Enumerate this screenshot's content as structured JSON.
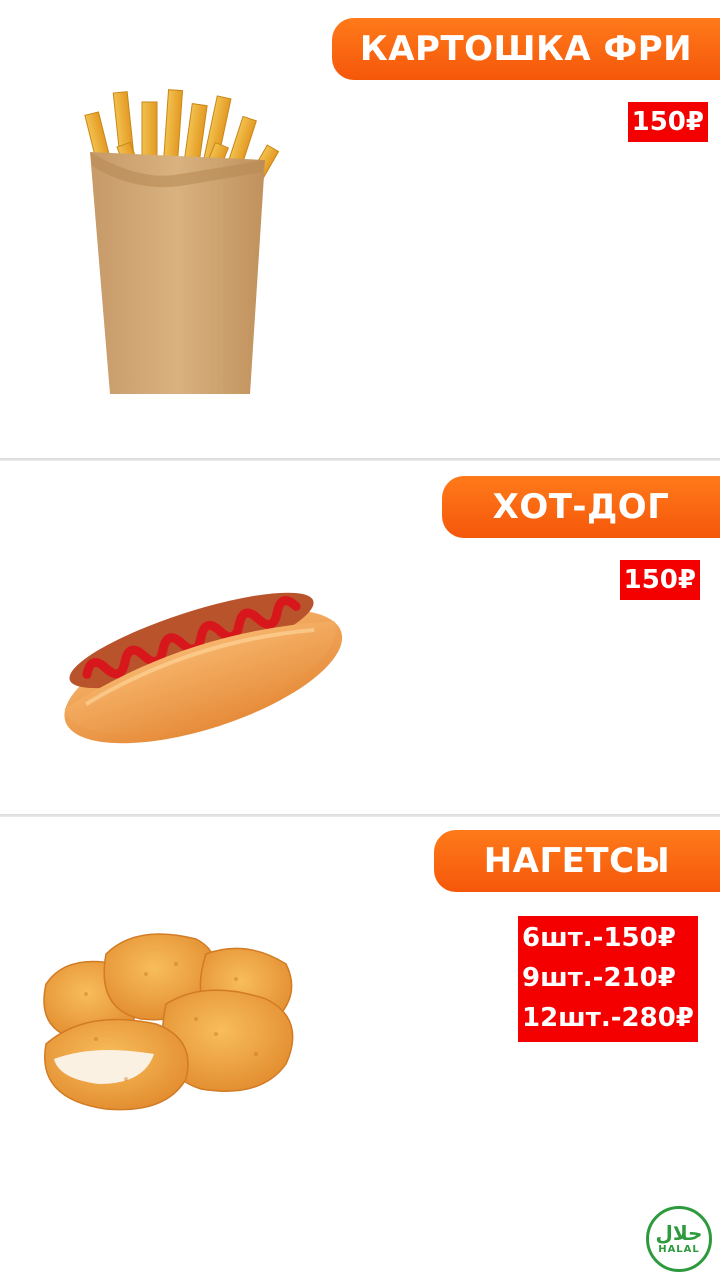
{
  "items": [
    {
      "name": "КАРТОШКА ФРИ",
      "price": "150₽",
      "image_icon": "fries-icon"
    },
    {
      "name": "ХОТ-ДОГ",
      "price": "150₽",
      "image_icon": "hotdog-icon"
    },
    {
      "name": "НАГЕТСЫ",
      "prices": [
        "6шт.-150₽",
        "9шт.-210₽",
        "12шт.-280₽"
      ],
      "image_icon": "nuggets-icon"
    }
  ],
  "halal_badge": {
    "arabic": "حلال",
    "label": "HALAL"
  },
  "colors": {
    "banner": "#f5570a",
    "price_bg": "#f40000",
    "halal": "#2e9a3e"
  }
}
